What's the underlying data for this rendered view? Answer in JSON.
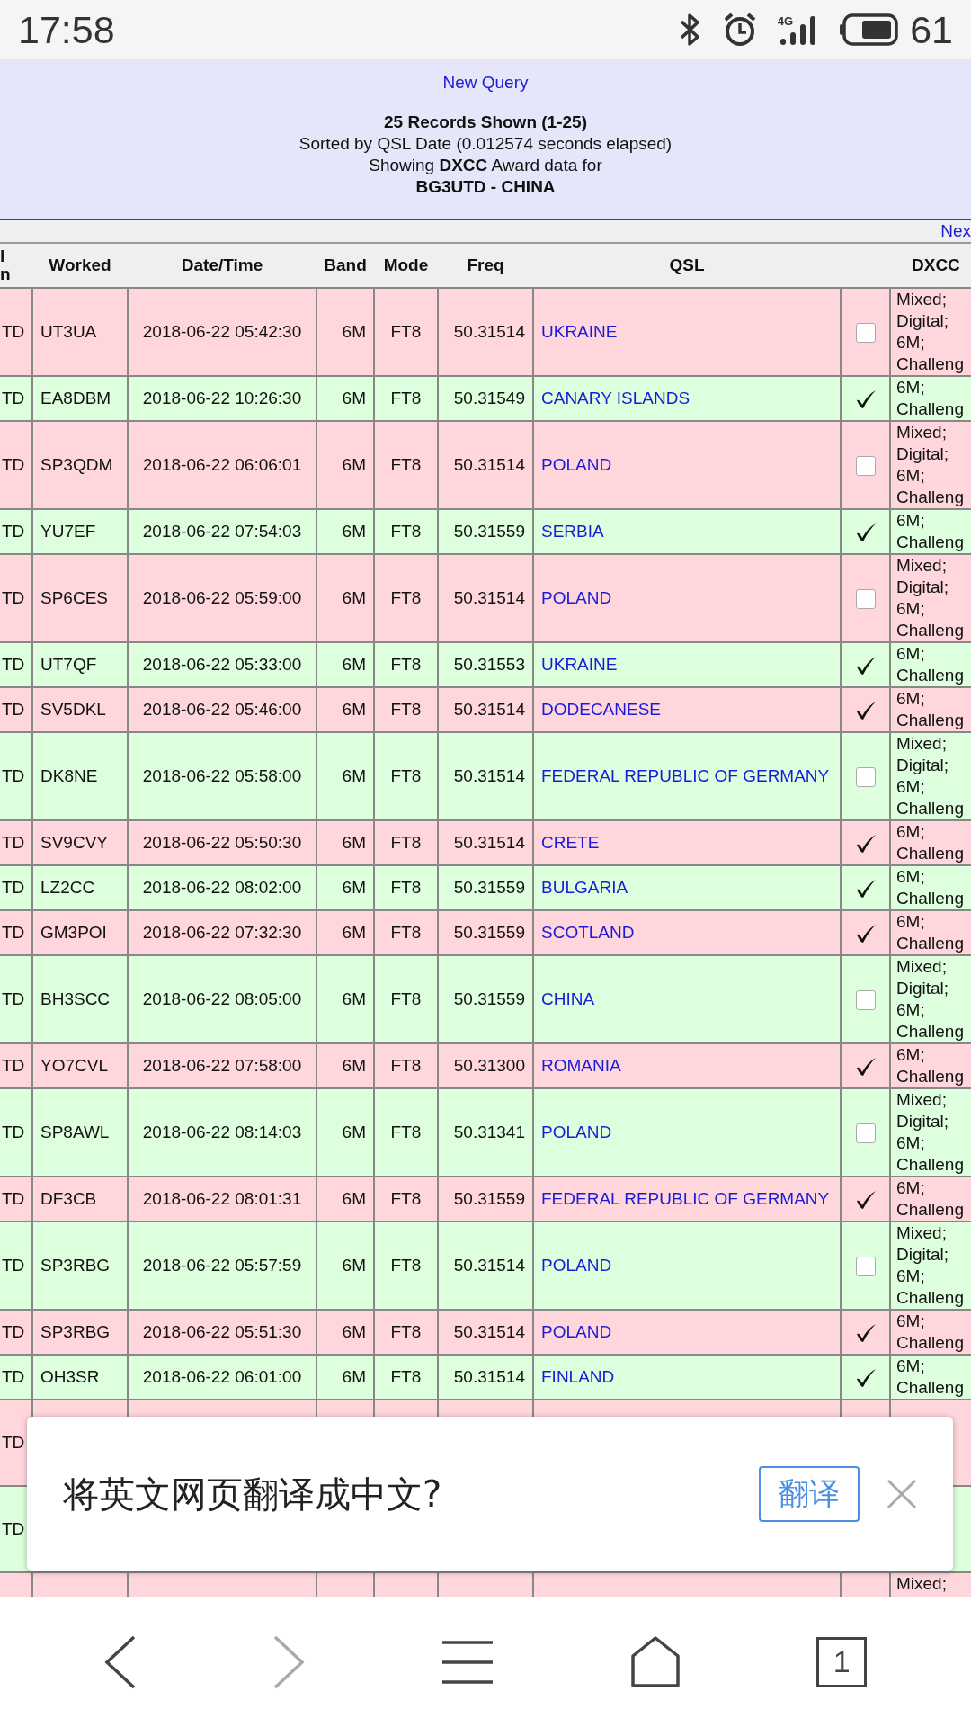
{
  "status_bar": {
    "time": "17:58",
    "network": "4G",
    "battery": "61"
  },
  "header": {
    "link": "New Query",
    "records": "25 Records Shown (1-25)",
    "sorted": "Sorted by QSL Date (0.012574 seconds elapsed)",
    "showing": "Showing **DXCC** Award data for",
    "station": "BG3UTD - CHINA"
  },
  "pager": {
    "next": "Nex"
  },
  "table": {
    "columns": [
      "l\nn",
      "Worked",
      "Date/Time",
      "Band",
      "Mode",
      "Freq",
      "QSL",
      "DXCC"
    ],
    "rows": [
      {
        "kind": "full",
        "color": "#ffd6dc",
        "column_1": "TD",
        "worked": "UT3UA",
        "datetime": "2018-06-22 05:42:30",
        "band": "6M",
        "mode": "FT8",
        "freq": "50.31514",
        "qsl": "UKRAINE",
        "checked": false,
        "dxcc": "Mixed; Digital; 6M; Challeng"
      },
      {
        "kind": "full",
        "color": "#ddffdd",
        "column_1": "TD",
        "worked": "EA8DBM",
        "datetime": "2018-06-22 10:26:30",
        "band": "6M",
        "mode": "FT8",
        "freq": "50.31549",
        "qsl": "CANARY ISLANDS",
        "checked": true,
        "dxcc": "6M; Challeng"
      },
      {
        "kind": "full",
        "color": "#ffd6dc",
        "column_1": "TD",
        "worked": "SP3QDM",
        "datetime": "2018-06-22 06:06:01",
        "band": "6M",
        "mode": "FT8",
        "freq": "50.31514",
        "qsl": "POLAND",
        "checked": false,
        "dxcc": "Mixed; Digital; 6M; Challeng"
      },
      {
        "kind": "full",
        "color": "#ddffdd",
        "column_1": "TD",
        "worked": "YU7EF",
        "datetime": "2018-06-22 07:54:03",
        "band": "6M",
        "mode": "FT8",
        "freq": "50.31559",
        "qsl": "SERBIA",
        "checked": true,
        "dxcc": "6M; Challeng"
      },
      {
        "kind": "full",
        "color": "#ffd6dc",
        "column_1": "TD",
        "worked": "SP6CES",
        "datetime": "2018-06-22 05:59:00",
        "band": "6M",
        "mode": "FT8",
        "freq": "50.31514",
        "qsl": "POLAND",
        "checked": false,
        "dxcc": "Mixed; Digital; 6M; Challeng"
      },
      {
        "kind": "full",
        "color": "#ddffdd",
        "column_1": "TD",
        "worked": "UT7QF",
        "datetime": "2018-06-22 05:33:00",
        "band": "6M",
        "mode": "FT8",
        "freq": "50.31553",
        "qsl": "UKRAINE",
        "checked": true,
        "dxcc": "6M; Challeng"
      },
      {
        "kind": "full",
        "color": "#ffd6dc",
        "column_1": "TD",
        "worked": "SV5DKL",
        "datetime": "2018-06-22 05:46:00",
        "band": "6M",
        "mode": "FT8",
        "freq": "50.31514",
        "qsl": "DODECANESE",
        "checked": true,
        "dxcc": "6M; Challeng"
      },
      {
        "kind": "full",
        "color": "#ddffdd",
        "column_1": "TD",
        "worked": "DK8NE",
        "datetime": "2018-06-22 05:58:00",
        "band": "6M",
        "mode": "FT8",
        "freq": "50.31514",
        "qsl": "FEDERAL REPUBLIC OF GERMANY",
        "checked": false,
        "dxcc": "Mixed; Digital; 6M; Challeng"
      },
      {
        "kind": "full",
        "color": "#ffd6dc",
        "column_1": "TD",
        "worked": "SV9CVY",
        "datetime": "2018-06-22 05:50:30",
        "band": "6M",
        "mode": "FT8",
        "freq": "50.31514",
        "qsl": "CRETE",
        "checked": true,
        "dxcc": "6M; Challeng"
      },
      {
        "kind": "full",
        "color": "#ddffdd",
        "column_1": "TD",
        "worked": "LZ2CC",
        "datetime": "2018-06-22 08:02:00",
        "band": "6M",
        "mode": "FT8",
        "freq": "50.31559",
        "qsl": "BULGARIA",
        "checked": true,
        "dxcc": "6M; Challeng"
      },
      {
        "kind": "full",
        "color": "#ffd6dc",
        "column_1": "TD",
        "worked": "GM3POI",
        "datetime": "2018-06-22 07:32:30",
        "band": "6M",
        "mode": "FT8",
        "freq": "50.31559",
        "qsl": "SCOTLAND",
        "checked": true,
        "dxcc": "6M; Challeng"
      },
      {
        "kind": "full",
        "color": "#ddffdd",
        "column_1": "TD",
        "worked": "BH3SCC",
        "datetime": "2018-06-22 08:05:00",
        "band": "6M",
        "mode": "FT8",
        "freq": "50.31559",
        "qsl": "CHINA",
        "checked": false,
        "dxcc": "Mixed; Digital; 6M; Challeng"
      },
      {
        "kind": "full",
        "color": "#ffd6dc",
        "column_1": "TD",
        "worked": "YO7CVL",
        "datetime": "2018-06-22 07:58:00",
        "band": "6M",
        "mode": "FT8",
        "freq": "50.31300",
        "qsl": "ROMANIA",
        "checked": true,
        "dxcc": "6M; Challeng"
      },
      {
        "kind": "full",
        "color": "#ddffdd",
        "column_1": "TD",
        "worked": "SP8AWL",
        "datetime": "2018-06-22 08:14:03",
        "band": "6M",
        "mode": "FT8",
        "freq": "50.31341",
        "qsl": "POLAND",
        "checked": false,
        "dxcc": "Mixed; Digital; 6M; Challeng"
      },
      {
        "kind": "full",
        "color": "#ffd6dc",
        "column_1": "TD",
        "worked": "DF3CB",
        "datetime": "2018-06-22 08:01:31",
        "band": "6M",
        "mode": "FT8",
        "freq": "50.31559",
        "qsl": "FEDERAL REPUBLIC OF GERMANY",
        "checked": true,
        "dxcc": "6M; Challeng"
      },
      {
        "kind": "full",
        "color": "#ddffdd",
        "column_1": "TD",
        "worked": "SP3RBG",
        "datetime": "2018-06-22 05:57:59",
        "band": "6M",
        "mode": "FT8",
        "freq": "50.31514",
        "qsl": "POLAND",
        "checked": false,
        "dxcc": "Mixed; Digital; 6M; Challeng"
      },
      {
        "kind": "full",
        "color": "#ffd6dc",
        "column_1": "TD",
        "worked": "SP3RBG",
        "datetime": "2018-06-22 05:51:30",
        "band": "6M",
        "mode": "FT8",
        "freq": "50.31514",
        "qsl": "POLAND",
        "checked": true,
        "dxcc": "6M; Challeng"
      },
      {
        "kind": "full",
        "color": "#ddffdd",
        "column_1": "TD",
        "worked": "OH3SR",
        "datetime": "2018-06-22 06:01:00",
        "band": "6M",
        "mode": "FT8",
        "freq": "50.31514",
        "qsl": "FINLAND",
        "checked": true,
        "dxcc": "6M; Challeng"
      },
      {
        "kind": "partial",
        "color": "#ffd6dc",
        "column_1": "TD"
      },
      {
        "kind": "partial",
        "color": "#ddffdd",
        "column_1": "TD"
      },
      {
        "kind": "partial",
        "color": "#ffd6dc",
        "dxcc": "Mixed;"
      }
    ]
  },
  "translate_prompt": {
    "message": "将英文网页翻译成中文?",
    "button": "翻译"
  },
  "bottom_nav": {
    "tabs_count": "1",
    "forward_disabled": true
  }
}
